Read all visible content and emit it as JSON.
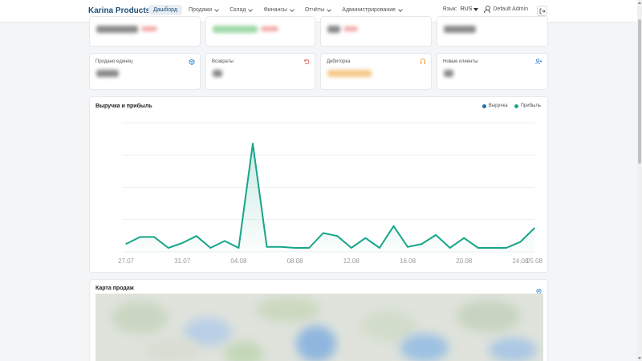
{
  "navbar": {
    "brand": "Karina Products",
    "menu": [
      {
        "label": "Дашборд",
        "active": true,
        "dropdown": false
      },
      {
        "label": "Продажи",
        "active": false,
        "dropdown": true
      },
      {
        "label": "Склад",
        "active": false,
        "dropdown": true
      },
      {
        "label": "Финансы",
        "active": false,
        "dropdown": true
      },
      {
        "label": "Отчёты",
        "active": false,
        "dropdown": true
      },
      {
        "label": "Администрирование",
        "active": false,
        "dropdown": true
      }
    ],
    "language_label": "Язык:",
    "language_value": "RUS",
    "user_name": "Default Admin"
  },
  "stats_row2": [
    {
      "label": "Продано единиц",
      "icon": "box-icon",
      "icon_color": "#2f8fd8"
    },
    {
      "label": "Возвраты",
      "icon": "undo-icon",
      "icon_color": "#e25555"
    },
    {
      "label": "Дебиторка",
      "icon": "wallet-icon",
      "icon_color": "#f0a23a"
    },
    {
      "label": "Новые клиенты",
      "icon": "user-plus-icon",
      "icon_color": "#3a7fd4"
    }
  ],
  "chart": {
    "title": "Выручка и прибыль",
    "legend": [
      {
        "name": "Выручка",
        "color": "#1f6fa8"
      },
      {
        "name": "Прибыль",
        "color": "#17a589"
      }
    ]
  },
  "chart_data": {
    "type": "line",
    "title": "Выручка и прибыль",
    "x": [
      "27.07",
      "28.07",
      "29.07",
      "30.07",
      "31.07",
      "01.08",
      "02.08",
      "03.08",
      "04.08",
      "05.08",
      "06.08",
      "07.08",
      "08.08",
      "09.08",
      "10.08",
      "11.08",
      "12.08",
      "13.08",
      "14.08",
      "15.08",
      "16.08",
      "17.08",
      "18.08",
      "19.08",
      "20.08",
      "21.08",
      "22.08",
      "23.08",
      "24.08",
      "25.08"
    ],
    "x_tick_labels": [
      "27.07",
      "31.07",
      "04.08",
      "08.08",
      "12.08",
      "16.08",
      "20.08",
      "24.08",
      "25.08"
    ],
    "series": [
      {
        "name": "Прибыль",
        "color": "#17a589",
        "values": [
          8,
          15,
          15,
          4,
          9,
          16,
          4,
          11,
          4,
          109,
          5,
          5,
          4,
          4,
          19,
          16,
          4,
          14,
          4,
          26,
          5,
          8,
          17,
          4,
          14,
          4,
          4,
          4,
          10,
          24
        ]
      },
      {
        "name": "Выручка",
        "color": "#1f6fa8",
        "values": []
      }
    ],
    "ylim": [
      0,
      130
    ],
    "grid": true,
    "legend_position": "top-right"
  },
  "map": {
    "title": "Карта продаж"
  }
}
